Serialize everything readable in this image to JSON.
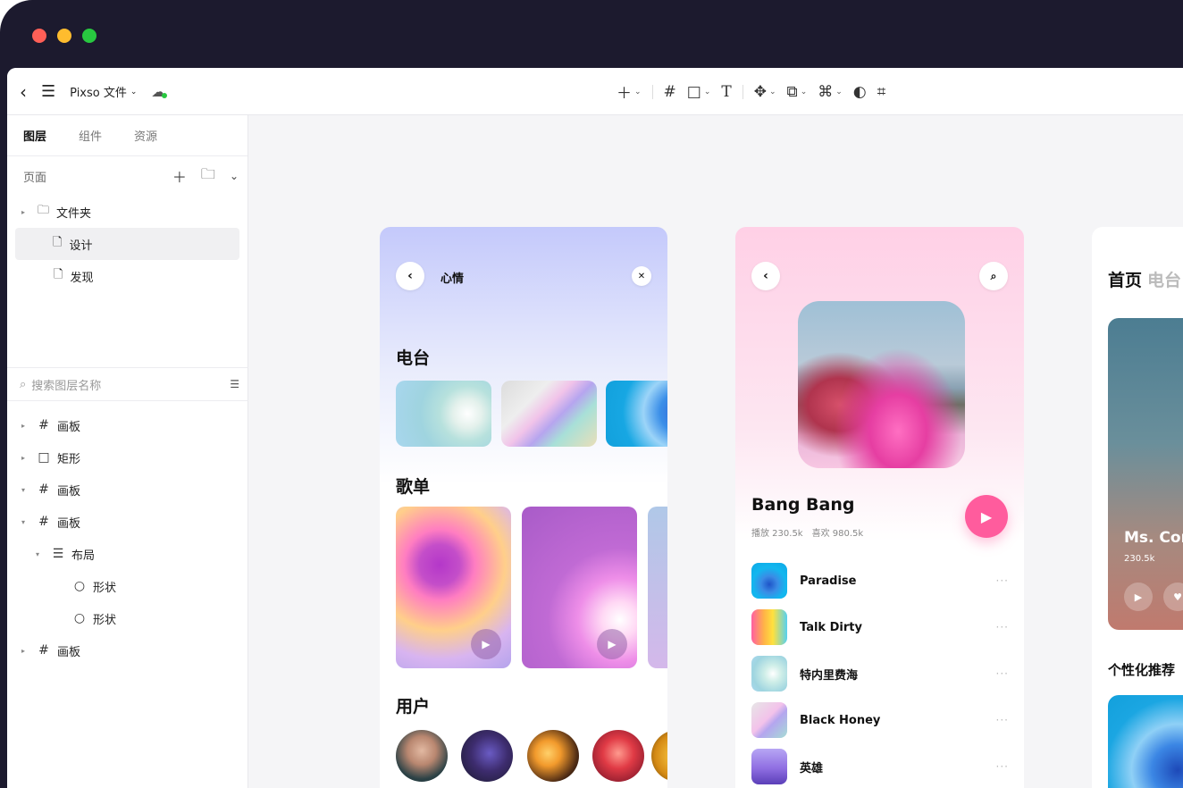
{
  "app": {
    "file_name": "Pixso 文件",
    "colors": {
      "accent_pink": "#ff5c9d",
      "window_bg": "#1c1a2e",
      "cloud_status": "#28c840"
    }
  },
  "toolbar": {
    "icons": [
      "plus-icon",
      "frame-icon",
      "rectangle-icon",
      "text-icon",
      "move-icon",
      "boolean-icon",
      "component-icon",
      "mask-icon",
      "crop-icon"
    ]
  },
  "sidebar": {
    "tabs": [
      {
        "label": "图层",
        "active": true
      },
      {
        "label": "组件",
        "active": false
      },
      {
        "label": "资源",
        "active": false
      }
    ],
    "pages_label": "页面",
    "pages": [
      {
        "label": "文件夹",
        "type": "folder"
      },
      {
        "label": "设计",
        "type": "page",
        "selected": true
      },
      {
        "label": "发现",
        "type": "page"
      }
    ],
    "search_placeholder": "搜索图层名称",
    "layers": [
      {
        "label": "画板",
        "icon": "frame-icon"
      },
      {
        "label": "矩形",
        "icon": "rectangle-icon"
      },
      {
        "label": "画板",
        "icon": "frame-icon"
      },
      {
        "label": "画板",
        "icon": "frame-icon"
      },
      {
        "label": "布局",
        "icon": "layout-icon"
      },
      {
        "label": "形状",
        "icon": "ellipse-icon"
      },
      {
        "label": "形状",
        "icon": "ellipse-icon"
      },
      {
        "label": "画板",
        "icon": "frame-icon"
      }
    ]
  },
  "card_mood": {
    "title": "心情",
    "section_radio": "电台",
    "section_playlist": "歌单",
    "section_users": "用户"
  },
  "card_player": {
    "song_title": "Bang Bang",
    "meta": "播放 230.5k　喜欢 980.5k",
    "tracks": [
      {
        "name": "Paradise"
      },
      {
        "name": "Talk Dirty"
      },
      {
        "name": "特内里费海"
      },
      {
        "name": "Black Honey"
      },
      {
        "name": "英雄"
      }
    ]
  },
  "card_home": {
    "home_tab": "首页",
    "radio_tab": "电台",
    "hero_title": "Ms. Cor",
    "hero_sub": "230.5k",
    "recommend": "个性化推荐"
  }
}
